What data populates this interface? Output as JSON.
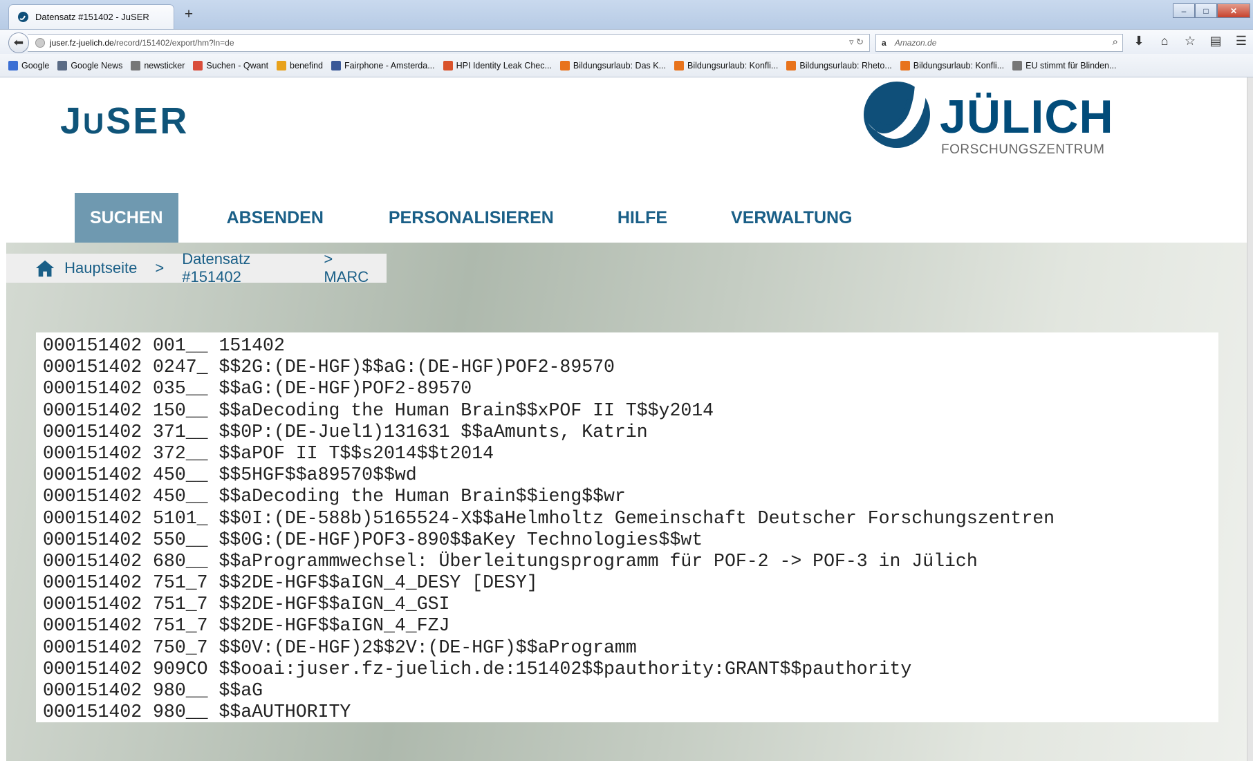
{
  "browser": {
    "tab_title": "Datensatz #151402 - JuSER",
    "new_tab": "+",
    "window_controls": {
      "minimize": "–",
      "maximize": "□",
      "close": "✕"
    },
    "url_host": "juser.fz-juelich.de",
    "url_path": "/record/151402/export/hm?ln=de",
    "search_engine": "a",
    "search_placeholder": "Amazon.de",
    "bookmarks": [
      {
        "label": "Google",
        "icon": "google-icon",
        "color": "#3b6fd4"
      },
      {
        "label": "Google News",
        "icon": "news-icon",
        "color": "#5a6b85"
      },
      {
        "label": "newsticker",
        "icon": "at-icon",
        "color": "#777777"
      },
      {
        "label": "Suchen - Qwant",
        "icon": "qwant-icon",
        "color": "#d94d3b"
      },
      {
        "label": "benefind",
        "icon": "benefind-icon",
        "color": "#e8a21c"
      },
      {
        "label": "Fairphone - Amsterda...",
        "icon": "facebook-icon",
        "color": "#3b5998"
      },
      {
        "label": "HPI Identity Leak Chec...",
        "icon": "hpi-icon",
        "color": "#d9532c"
      },
      {
        "label": "Bildungsurlaub: Das K...",
        "icon": "bildung-icon",
        "color": "#e8731c"
      },
      {
        "label": "Bildungsurlaub: Konfli...",
        "icon": "bildung-icon",
        "color": "#e8731c"
      },
      {
        "label": "Bildungsurlaub: Rheto...",
        "icon": "bildung-icon",
        "color": "#e8731c"
      },
      {
        "label": "Bildungsurlaub: Konfli...",
        "icon": "bildung-icon",
        "color": "#e8731c"
      },
      {
        "label": "EU stimmt für Blinden...",
        "icon": "at-icon",
        "color": "#777777"
      }
    ]
  },
  "site": {
    "logo_j": "J",
    "logo_u": "U",
    "logo_rest": "SER",
    "brand_name": "JÜLICH",
    "brand_sub": "FORSCHUNGSZENTRUM",
    "brand_color": "#024c7a"
  },
  "nav": {
    "items": [
      "SUCHEN",
      "ABSENDEN",
      "PERSONALISIEREN",
      "HILFE",
      "VERWALTUNG"
    ],
    "active": "SUCHEN"
  },
  "breadcrumb": {
    "home": "Hauptseite",
    "sep": ">",
    "record": "Datensatz #151402",
    "current": "> MARC"
  },
  "marc_lines": [
    "000151402 001__ 151402",
    "000151402 0247_ $$2G:(DE-HGF)$$aG:(DE-HGF)POF2-89570",
    "000151402 035__ $$aG:(DE-HGF)POF2-89570",
    "000151402 150__ $$aDecoding the Human Brain$$xPOF II T$$y2014",
    "000151402 371__ $$0P:(DE-Juel1)131631 $$aAmunts, Katrin",
    "000151402 372__ $$aPOF II T$$s2014$$t2014",
    "000151402 450__ $$5HGF$$a89570$$wd",
    "000151402 450__ $$aDecoding the Human Brain$$ieng$$wr",
    "000151402 5101_ $$0I:(DE-588b)5165524-X$$aHelmholtz Gemeinschaft Deutscher Forschungszentren",
    "000151402 550__ $$0G:(DE-HGF)POF3-890$$aKey Technologies$$wt",
    "000151402 680__ $$aProgrammwechsel: Überleitungsprogramm für POF-2 -> POF-3 in Jülich",
    "000151402 751_7 $$2DE-HGF$$aIGN_4_DESY [DESY]",
    "000151402 751_7 $$2DE-HGF$$aIGN_4_GSI",
    "000151402 751_7 $$2DE-HGF$$aIGN_4_FZJ",
    "000151402 750_7 $$0V:(DE-HGF)2$$2V:(DE-HGF)$$aProgramm",
    "000151402 909CO $$ooai:juser.fz-juelich.de:151402$$pauthority:GRANT$$pauthority",
    "000151402 980__ $$aG",
    "000151402 980__ $$aAUTHORITY"
  ]
}
